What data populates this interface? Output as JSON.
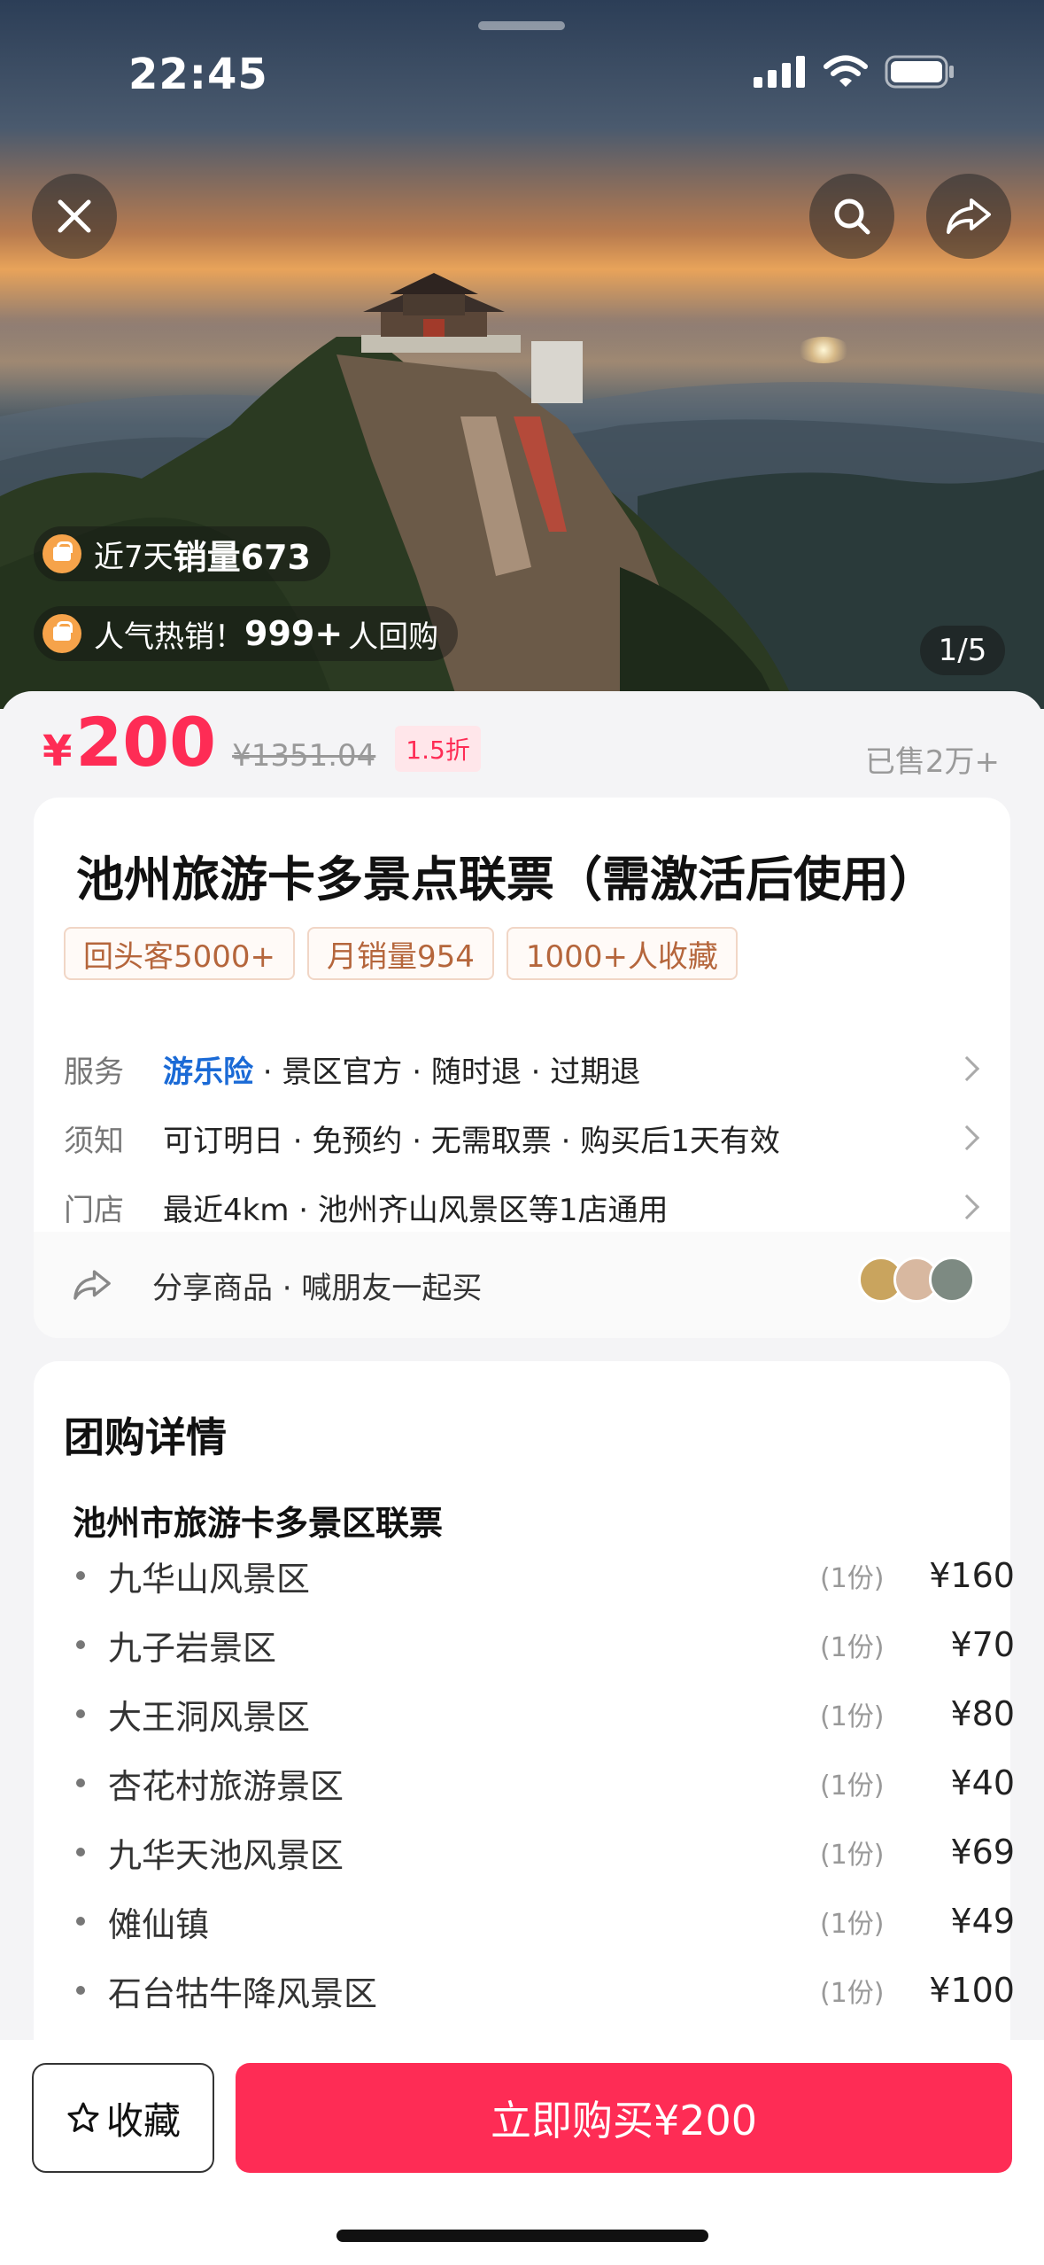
{
  "status_bar": {
    "time": "22:45"
  },
  "hero": {
    "close_icon": "close-icon",
    "search_icon": "search-icon",
    "share_icon": "share-icon",
    "badge1": {
      "prefix": "近7天",
      "bold": "销量673"
    },
    "badge2": {
      "prefix": "人气热销！",
      "bold": "999+",
      "suffix": "人回购"
    },
    "image_counter": "1/5"
  },
  "price": {
    "currency": "¥",
    "amount": "200",
    "original": "¥1351.04",
    "discount": "1.5折",
    "sold": "已售2万+"
  },
  "product": {
    "title": "池州旅游卡多景点联票（需激活后使用）",
    "tags": [
      "回头客5000+",
      "月销量954",
      "1000+人收藏"
    ],
    "service": {
      "label": "服务",
      "highlight": "游乐险",
      "rest": " · 景区官方 · 随时退 · 过期退"
    },
    "notice": {
      "label": "须知",
      "value": "可订明日 · 免预约 · 无需取票 · 购买后1天有效"
    },
    "store": {
      "label": "门店",
      "value": "最近4km · 池州齐山风景区等1店通用"
    },
    "share_text": "分享商品 · 喊朋友一起买"
  },
  "details": {
    "section_title": "团购详情",
    "package_title": "池州市旅游卡多景区联票",
    "items": [
      {
        "name": "九华山风景区",
        "qty": "(1份)",
        "price": "¥160"
      },
      {
        "name": "九子岩景区",
        "qty": "(1份)",
        "price": "¥70"
      },
      {
        "name": "大王洞风景区",
        "qty": "(1份)",
        "price": "¥80"
      },
      {
        "name": "杏花村旅游景区",
        "qty": "(1份)",
        "price": "¥40"
      },
      {
        "name": "九华天池风景区",
        "qty": "(1份)",
        "price": "¥69"
      },
      {
        "name": "傩仙镇",
        "qty": "(1份)",
        "price": "¥49"
      },
      {
        "name": "石台牯牛降风景区",
        "qty": "(1份)",
        "price": "¥100"
      }
    ]
  },
  "bottom_bar": {
    "favorite_label": "收藏",
    "buy_label": "立即购买¥200"
  },
  "colors": {
    "accent": "#fe2c55",
    "link": "#1a6ad6",
    "tag_text": "#b5663c"
  }
}
